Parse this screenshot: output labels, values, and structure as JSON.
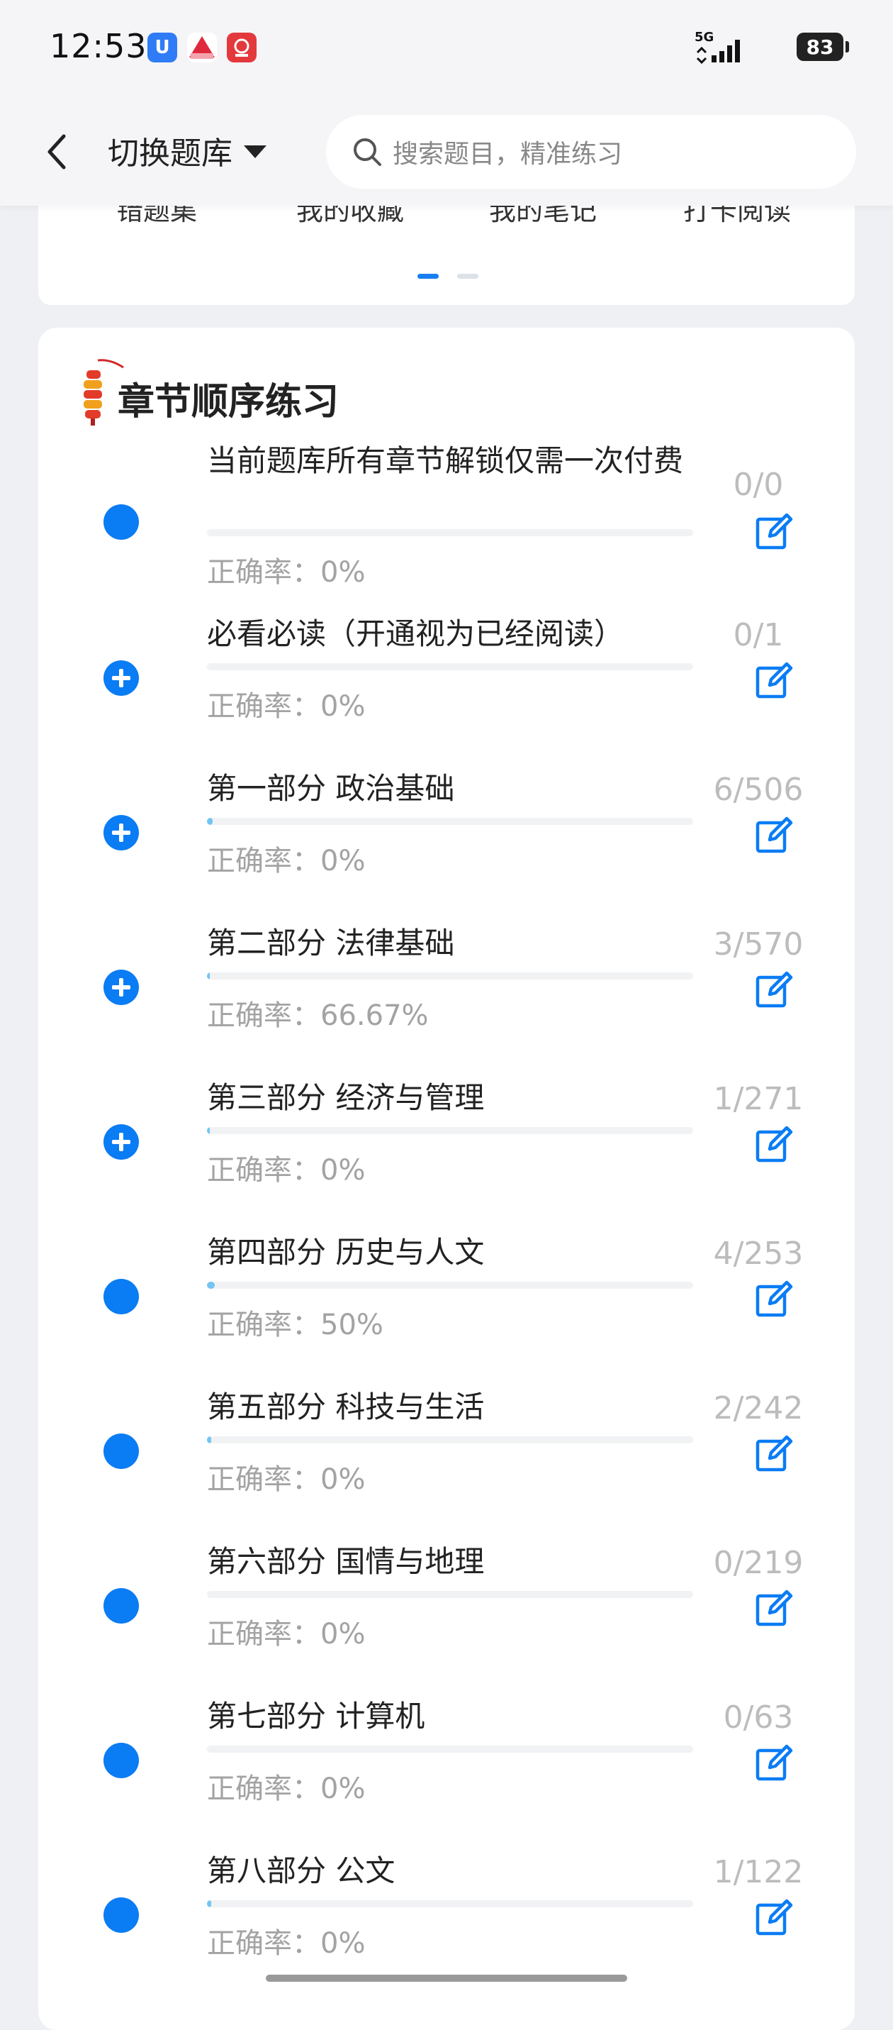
{
  "status": {
    "time": "12:53",
    "network": "5G",
    "battery": "83"
  },
  "header": {
    "switch_label": "切换题库",
    "search_placeholder": "搜索题目，精准练习"
  },
  "top_card": {
    "quick_links": [
      "错题集",
      "我的收藏",
      "我的笔记",
      "打卡阅读"
    ],
    "page_indicator": {
      "pages": 2,
      "active": 1
    }
  },
  "section": {
    "title": "章节顺序练习"
  },
  "accuracy_prefix": "正确率：",
  "chapters": [
    {
      "title": "当前题库所有章节解锁仅需一次付费",
      "count": "0/0",
      "accuracy": "0%",
      "progress": 0,
      "icon": "circle"
    },
    {
      "title": "必看必读（开通视为已经阅读）",
      "count": "0/1",
      "accuracy": "0%",
      "progress": 0,
      "icon": "plus"
    },
    {
      "title": "第一部分 政治基础",
      "count": "6/506",
      "accuracy": "0%",
      "progress": 0.0119,
      "icon": "plus"
    },
    {
      "title": "第二部分 法律基础",
      "count": "3/570",
      "accuracy": "66.67%",
      "progress": 0.0053,
      "icon": "plus"
    },
    {
      "title": "第三部分 经济与管理",
      "count": "1/271",
      "accuracy": "0%",
      "progress": 0.0037,
      "icon": "plus"
    },
    {
      "title": "第四部分 历史与人文",
      "count": "4/253",
      "accuracy": "50%",
      "progress": 0.0158,
      "icon": "circle"
    },
    {
      "title": "第五部分 科技与生活",
      "count": "2/242",
      "accuracy": "0%",
      "progress": 0.0083,
      "icon": "circle"
    },
    {
      "title": "第六部分 国情与地理",
      "count": "0/219",
      "accuracy": "0%",
      "progress": 0,
      "icon": "circle"
    },
    {
      "title": "第七部分 计算机",
      "count": "0/63",
      "accuracy": "0%",
      "progress": 0,
      "icon": "circle"
    },
    {
      "title": "第八部分 公文",
      "count": "1/122",
      "accuracy": "0%",
      "progress": 0.0082,
      "icon": "circle"
    }
  ],
  "colors": {
    "accent": "#0a7cf4",
    "progress": "#74c4f2",
    "muted": "#a3a3a3"
  }
}
